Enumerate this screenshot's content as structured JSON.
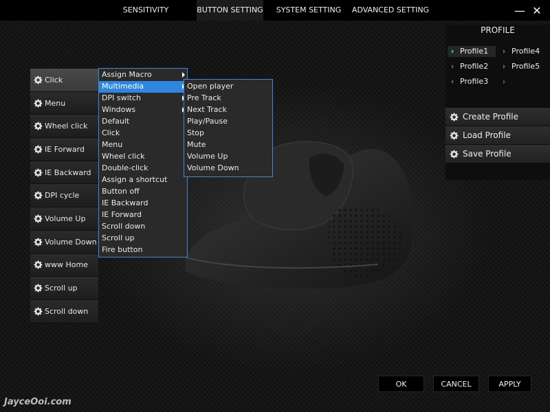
{
  "tabs": [
    "SENSITIVITY",
    "BUTTON SETTING",
    "SYSTEM SETTING",
    "ADVANCED SETTING"
  ],
  "window": {
    "minimize": "—",
    "close": "✕"
  },
  "buttons": [
    "Click",
    "Menu",
    "Wheel click",
    "IE Forward",
    "IE Backward",
    "DPI cycle",
    "Volume Up",
    "Volume Down",
    "www Home",
    "Scroll up",
    "Scroll down"
  ],
  "menu": [
    "Assign Macro",
    "Multimedia",
    "DPI switch",
    "Windows",
    "Default",
    "Click",
    "Menu",
    "Wheel click",
    "Double-click",
    "Assign a shortcut",
    "Button off",
    "IE Backward",
    "IE Forward",
    "Scroll down",
    "Scroll up",
    "Fire button"
  ],
  "submenu": [
    "Open player",
    "Pre Track",
    "Next Track",
    "Play/Pause",
    "Stop",
    "Mute",
    "Volume Up",
    "Volume Down"
  ],
  "profile": {
    "title": "PROFILE",
    "items": [
      "Profile1",
      "Profile4",
      "Profile2",
      "Profile5",
      "Profile3"
    ],
    "actions": [
      "Create Profile",
      "Load Profile",
      "Save Profile"
    ]
  },
  "footer": {
    "ok": "OK",
    "cancel": "CANCEL",
    "apply": "APPLY"
  },
  "watermark": "JayceOoi.com",
  "colors": {
    "highlight": "#2f86e0",
    "menu_border": "#3d8bd8",
    "active_profile_dot": "#37b6e0"
  }
}
